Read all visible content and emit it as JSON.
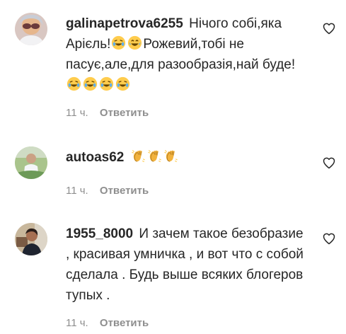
{
  "comments": [
    {
      "username": "galinapetrova6255",
      "segments": [
        {
          "text": "Нічого собі,яка Арієль!"
        },
        {
          "emoji": "rofl-emoji"
        },
        {
          "emoji": "joy-emoji"
        },
        {
          "text": "Рожевий,тобі не пасує,але,для разообразія,най буде!"
        },
        {
          "emoji": "rofl-emoji"
        },
        {
          "emoji": "rofl-emoji"
        },
        {
          "emoji": "rofl-emoji"
        },
        {
          "emoji": "rofl-emoji"
        }
      ],
      "time": "11 ч.",
      "reply_label": "Ответить",
      "like_icon": "heart-outline-icon"
    },
    {
      "username": "autoas62",
      "segments": [
        {
          "text": " "
        },
        {
          "emoji": "clapping-hands-emoji"
        },
        {
          "emoji": "clapping-hands-emoji"
        },
        {
          "emoji": "clapping-hands-emoji"
        }
      ],
      "time": "11 ч.",
      "reply_label": "Ответить",
      "like_icon": "heart-outline-icon"
    },
    {
      "username": "1955_8000",
      "segments": [
        {
          "text": "И зачем такое безобразие , красивая умничка , и вот что с собой сделала . Будь выше всяких блогеров тупых ."
        }
      ],
      "time": "11 ч.",
      "reply_label": "Ответить",
      "like_icon": "heart-outline-icon"
    }
  ],
  "colors": {
    "text": "#262626",
    "secondary": "#8e8e8e",
    "emoji_face": "#ffcc4d"
  }
}
